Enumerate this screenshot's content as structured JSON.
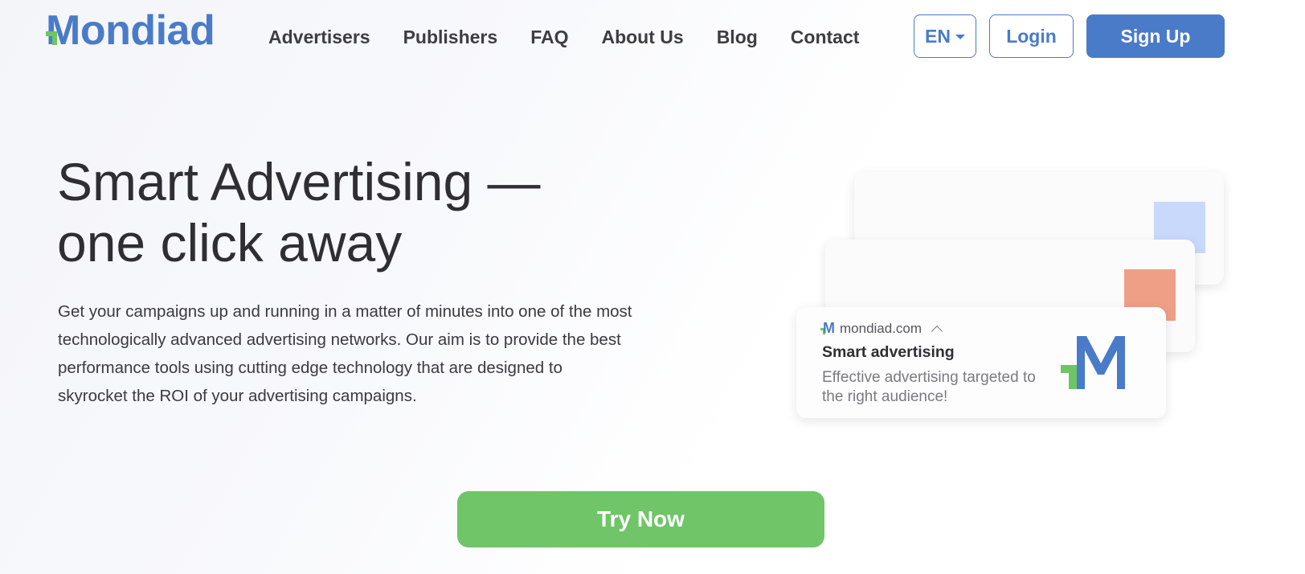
{
  "brand": {
    "logo_text": "Mondiad",
    "primary_color": "#4a7bc8",
    "accent_green": "#6dc563"
  },
  "nav": {
    "items": [
      {
        "label": "Advertisers"
      },
      {
        "label": "Publishers"
      },
      {
        "label": "FAQ"
      },
      {
        "label": "About Us"
      },
      {
        "label": "Blog"
      },
      {
        "label": "Contact"
      }
    ]
  },
  "header_actions": {
    "language": "EN",
    "login_label": "Login",
    "signup_label": "Sign Up"
  },
  "hero": {
    "title_line1": "Smart Advertising —",
    "title_line2": "one click away",
    "description": "Get your campaigns up and running in a matter of minutes into one of the most technologically advanced advertising networks. Our aim is to provide the best performance tools using cutting edge technology that are designed to skyrocket the ROI of your advertising campaigns."
  },
  "ad_preview": {
    "source": "mondiad.com",
    "title": "Smart advertising",
    "text": "Effective advertising targeted to the right audience!",
    "colors": {
      "back_square": "#c8d9fb",
      "mid_square": "#ee9f86"
    }
  },
  "cta": {
    "label": "Try Now",
    "color": "#6fc567"
  }
}
